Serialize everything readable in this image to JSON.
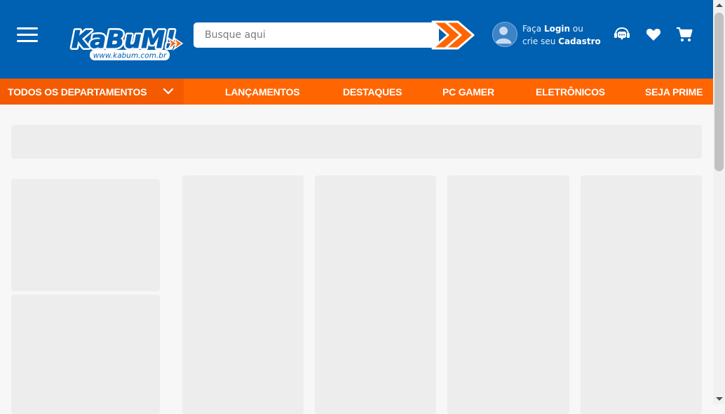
{
  "header": {
    "brand": "KaBuM!",
    "brand_url_text": "www.kabum.com.br",
    "search_placeholder": "Busque aqui",
    "account": {
      "line1_prefix": "Faça",
      "line1_link": "Login",
      "line1_suffix": "ou",
      "line2_prefix": "crie seu",
      "line2_link": "Cadastro"
    },
    "icons": [
      "menu-icon",
      "search-arrows-icon",
      "user-avatar-icon",
      "support-chat-icon",
      "heart-icon",
      "cart-icon"
    ]
  },
  "nav": {
    "departments_label": "TODOS OS DEPARTAMENTOS",
    "links": [
      "LANÇAMENTOS",
      "DESTAQUES",
      "PC GAMER",
      "ELETRÔNICOS",
      "SEJA PRIME"
    ]
  },
  "colors": {
    "header_blue": "#0060b1",
    "nav_orange": "#ff6500",
    "dept_orange": "#f45b00",
    "skeleton_gray": "#ededed",
    "page_bg": "#f7f7f7"
  }
}
